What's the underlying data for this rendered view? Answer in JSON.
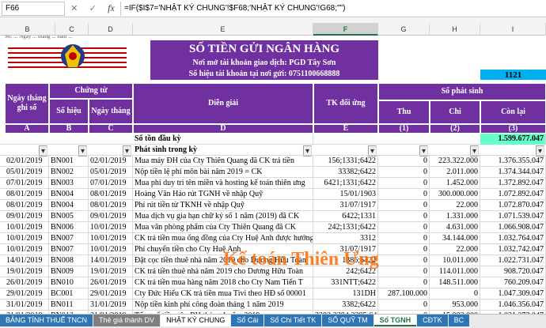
{
  "formula_bar": {
    "name_box": "F66",
    "formula": "=IF($I$7='NHẬT KÝ CHUNG'!$F68;'NHẬT KÝ CHUNG'!G68;\"\")"
  },
  "columns": [
    "B",
    "C",
    "D",
    "E",
    "F",
    "G",
    "H",
    "I"
  ],
  "selected_column": "F",
  "header": {
    "top_left_small": "Số: ... Ngày ... tháng ... năm ...",
    "title": "SỐ TIỀN GỬI NGÂN HÀNG",
    "line1": "Nơi mở tài khoản giao dịch: PGD Tây Sơn",
    "line2": "Số hiệu tài khoản tại nơi gửi: 0751100668888",
    "account": "1121"
  },
  "table_head": {
    "ngay_ghi_so": "Ngày tháng ghi sổ",
    "chung_tu": "Chứng từ",
    "so_hieu": "Số hiệu",
    "ngay_thang": "Ngày tháng",
    "dien_giai": "Diễn giải",
    "tk_doi_ung": "TK đối ứng",
    "so_phat_sinh": "Số phát sinh",
    "thu": "Thu",
    "chi": "Chi",
    "con_lai": "Còn lại",
    "letters": [
      "A",
      "B",
      "C",
      "D",
      "E",
      "(1)",
      "(2)",
      "(3)"
    ]
  },
  "opening": {
    "label": "Số tồn đầu kỳ",
    "balance": "1.599.677.047"
  },
  "period_label": "Phát sinh trong kỳ",
  "rows": [
    {
      "date": "02/01/2019",
      "doc": "BN001",
      "docdate": "02/01/2019",
      "desc": "Mua máy ĐH của Cty Thiên Quang đã CK trả tiền",
      "acct": "156;1331;6422",
      "thu": "0",
      "chi": "223.322.000",
      "bal": "1.376.355.047"
    },
    {
      "date": "05/01/2019",
      "doc": "BN002",
      "docdate": "05/01/2019",
      "desc": "Nộp tiền lệ phí môn bài năm 2019 = CK",
      "acct": "33382;6422",
      "thu": "0",
      "chi": "2.011.000",
      "bal": "1.374.344.047"
    },
    {
      "date": "07/01/2019",
      "doc": "BN003",
      "docdate": "07/01/2019",
      "desc": "Mua phí duy trì tên miền và hosting kế toán thiên ưng",
      "acct": "6421;1331;6422",
      "thu": "0",
      "chi": "1.452.000",
      "bal": "1.372.892.047"
    },
    {
      "date": "08/01/2019",
      "doc": "BN004",
      "docdate": "08/01/2019",
      "desc": "Hoàng Văn Hảo rút TGNH về nhập Quỹ",
      "acct": "15/01/1903",
      "thu": "0",
      "chi": "300.000.000",
      "bal": "1.072.892.047"
    },
    {
      "date": "08/01/2019",
      "doc": "BN004",
      "docdate": "08/01/2019",
      "desc": "Phí rút tiền từ TKNH về nhập Quỹ",
      "acct": "31/07/1917",
      "thu": "0",
      "chi": "22.000",
      "bal": "1.072.870.047"
    },
    {
      "date": "09/01/2019",
      "doc": "BN005",
      "docdate": "09/01/2019",
      "desc": "Mua dịch vụ gia hạn chữ ký số 1 năm (2019) đã CK",
      "acct": "6422;1331",
      "thu": "0",
      "chi": "1.331.000",
      "bal": "1.071.539.047"
    },
    {
      "date": "10/01/2019",
      "doc": "BN006",
      "docdate": "10/01/2019",
      "desc": "Mua văn phòng phẩm của Cty Thiên Quang đã CK",
      "acct": "242;1331;6422",
      "thu": "0",
      "chi": "4.631.000",
      "bal": "1.066.908.047"
    },
    {
      "date": "10/01/2019",
      "doc": "BN007",
      "docdate": "10/01/2019",
      "desc": "CK trả tiền mua ống đồng của Cty Huệ Anh được hưởng CK",
      "acct": "3312",
      "thu": "0",
      "chi": "34.144.000",
      "bal": "1.032.764.047"
    },
    {
      "date": "10/01/2019",
      "doc": "BN007",
      "docdate": "10/01/2019",
      "desc": "Phí chuyển tiền cho Cty Huệ Anh",
      "acct": "31/07/1917",
      "thu": "0",
      "chi": "22.000",
      "bal": "1.032.742.047"
    },
    {
      "date": "14/01/2019",
      "doc": "BN008",
      "docdate": "14/01/2019",
      "desc": "Đặt cọc tiền thuê nhà năm 2019 cho Dương Hữu Toàn",
      "acct": "1386;6422",
      "thu": "0",
      "chi": "10.011.000",
      "bal": "1.022.731.047"
    },
    {
      "date": "19/01/2019",
      "doc": "BN009",
      "docdate": "19/01/2019",
      "desc": "CK trả tiền thuê nhà năm 2019 cho Dương Hữu Toàn",
      "acct": "242;6422",
      "thu": "0",
      "chi": "114.011.000",
      "bal": "908.720.047"
    },
    {
      "date": "26/01/2019",
      "doc": "BN010",
      "docdate": "26/01/2019",
      "desc": "CK trả tiền mua hàng năm 2018 cho Cty Nam Tiến T",
      "acct": "331NTT;6422",
      "thu": "0",
      "chi": "148.511.000",
      "bal": "760.209.047"
    },
    {
      "date": "29/01/2019",
      "doc": "BC001",
      "docdate": "29/01/2019",
      "desc": "Cty Đức Hiếu CK trả tiền mua Tivi theo HĐ số 00001",
      "acct": "131DH",
      "thu": "287.100.000",
      "chi": "0",
      "bal": "1.047.309.047"
    },
    {
      "date": "31/01/2019",
      "doc": "BN011",
      "docdate": "31/01/2019",
      "desc": "Nộp tiền kinh phí công đoàn tháng 1 năm 2019",
      "acct": "3382;6422",
      "thu": "0",
      "chi": "953.000",
      "bal": "1.046.356.047"
    },
    {
      "date": "31/01/2019",
      "doc": "BN012",
      "docdate": "31/01/2019",
      "desc": "Tổng số tiền nộp BH tháng 1 năm 2019",
      "acct": "3383;3384;3385;6422",
      "thu": "0",
      "chi": "15.083.000",
      "bal": "1.031.273.047"
    },
    {
      "date": "31/01/2019",
      "doc": "BN012",
      "docdate": "31/01/2019",
      "desc": "Phí chuyển tiền nộp bảo hiểm tháng 1 năm 2019",
      "acct": "29/05/1901",
      "thu": "0",
      "chi": "6.600",
      "bal": "1.031.266.447"
    }
  ],
  "watermark": "Kế toán Thiên Ưng",
  "sheet_tabs": [
    {
      "label": "BẢNG TÍNH THUẾ TNCN",
      "color": "#2e75b6"
    },
    {
      "label": "Thẻ giá thành DV",
      "color": "#7f7f7f"
    },
    {
      "label": "NHẬT KÝ CHUNG",
      "color": "#ffffff",
      "text": "#000"
    },
    {
      "label": "Sổ Cái",
      "color": "#2e75b6"
    },
    {
      "label": "Sổ Chi Tiết TK",
      "color": "#2e75b6"
    },
    {
      "label": "SỔ QUỸ TM",
      "color": "#2e75b6"
    },
    {
      "label": "Sổ TGNH",
      "color": "#ffffff",
      "active": true
    },
    {
      "label": "CĐTK",
      "color": "#2e75b6"
    },
    {
      "label": "BC",
      "color": "#2e75b6"
    }
  ]
}
